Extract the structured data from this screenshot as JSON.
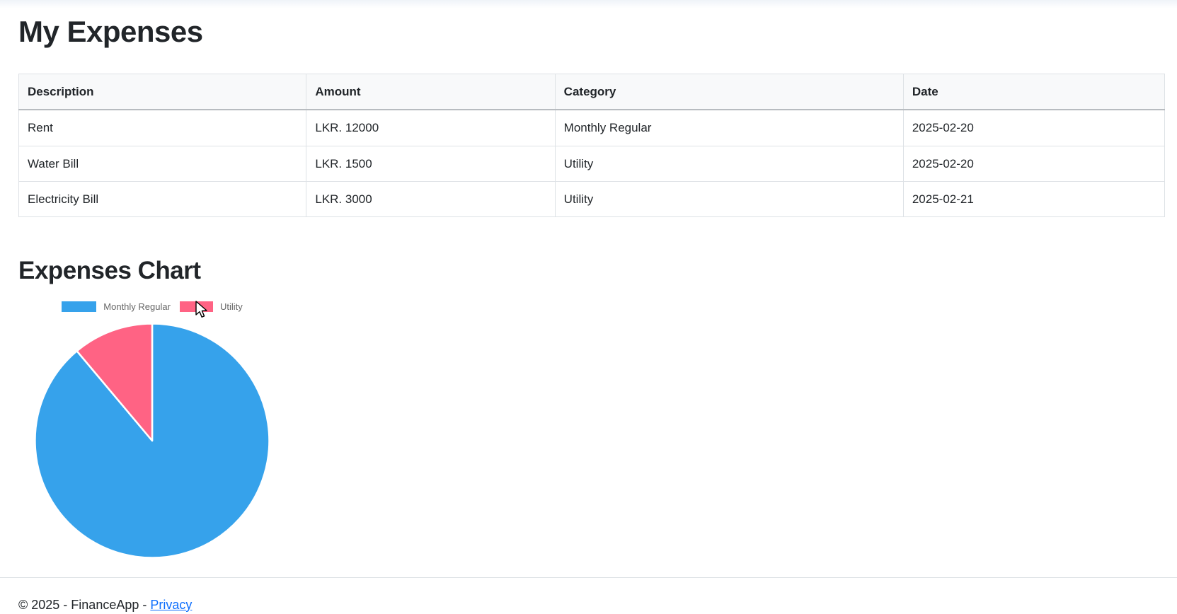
{
  "page": {
    "title": "My Expenses",
    "chart_heading": "Expenses Chart"
  },
  "table": {
    "headers": [
      "Description",
      "Amount",
      "Category",
      "Date"
    ],
    "rows": [
      [
        "Rent",
        "LKR. 12000",
        "Monthly Regular",
        "2025-02-20"
      ],
      [
        "Water Bill",
        "LKR. 1500",
        "Utility",
        "2025-02-20"
      ],
      [
        "Electricity Bill",
        "LKR. 3000",
        "Utility",
        "2025-02-21"
      ]
    ]
  },
  "chart_data": {
    "type": "pie",
    "title": "Expenses Chart",
    "categories": [
      "Monthly Regular",
      "Utility"
    ],
    "values": [
      12000,
      1500
    ],
    "colors": [
      "#36A2EB",
      "#FF6384"
    ],
    "slice_angles_deg": [
      320,
      40
    ],
    "legend_position": "top",
    "legend": [
      "Monthly Regular",
      "Utility"
    ]
  },
  "footer": {
    "copyright": "© 2025 - FinanceApp - ",
    "privacy_label": "Privacy"
  },
  "colors": {
    "accent_blue": "#36A2EB",
    "accent_pink": "#FF6384",
    "link_blue": "#0d6efd",
    "border_gray": "#dee2e6",
    "header_bg": "#f8f9fa",
    "legend_text": "#666666",
    "body_text": "#212529"
  }
}
